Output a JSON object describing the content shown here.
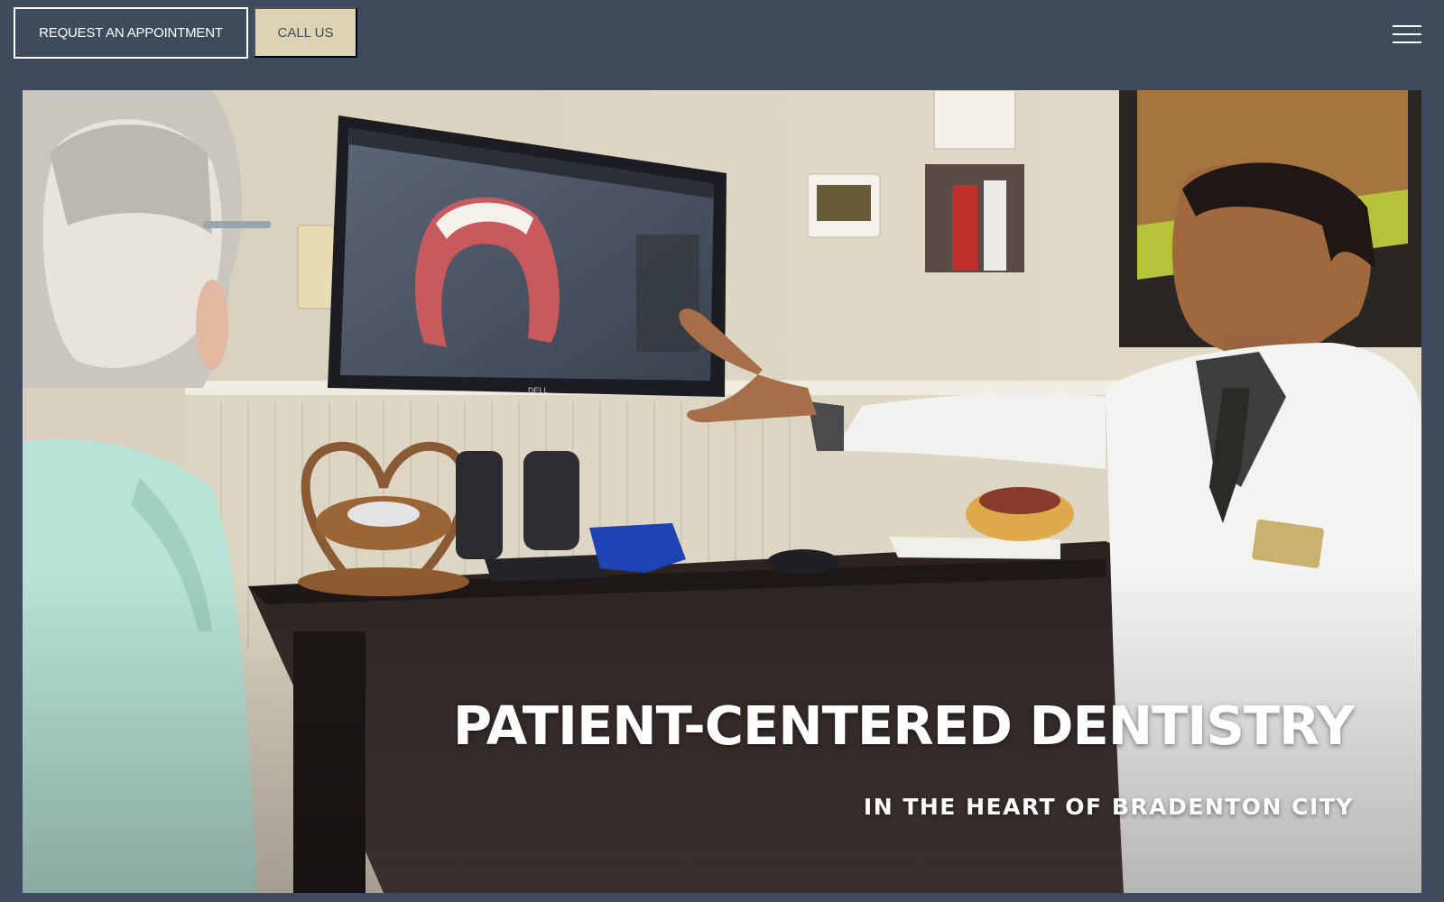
{
  "header": {
    "appointment_label": "REQUEST AN APPOINTMENT",
    "call_label": "CALL US",
    "menu_icon": "hamburger-menu-icon"
  },
  "hero": {
    "title": "PATIENT-CENTERED DENTISTRY",
    "subtitle": "IN THE HEART OF BRADENTON CITY",
    "image": "dentist-showing-patient-dental-model-on-monitor"
  },
  "colors": {
    "header_bg": "#3d4b5c",
    "accent_button": "#ddd3b3",
    "text_light": "#ffffff"
  }
}
